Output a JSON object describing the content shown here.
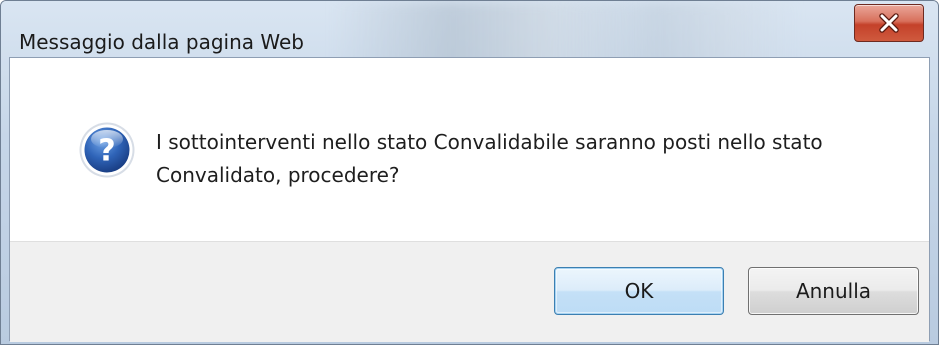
{
  "dialog": {
    "title": "Messaggio dalla pagina Web",
    "message": "I sottointerventi nello stato Convalidabile saranno posti nello stato Convalidato, procedere?",
    "icon": "question-icon",
    "close_icon": "close-icon"
  },
  "buttons": {
    "ok_label": "OK",
    "cancel_label": "Annulla"
  },
  "colors": {
    "close_button": "#c4412a",
    "ok_border": "#3c7fb1",
    "question_icon": "#2a5fb0"
  }
}
